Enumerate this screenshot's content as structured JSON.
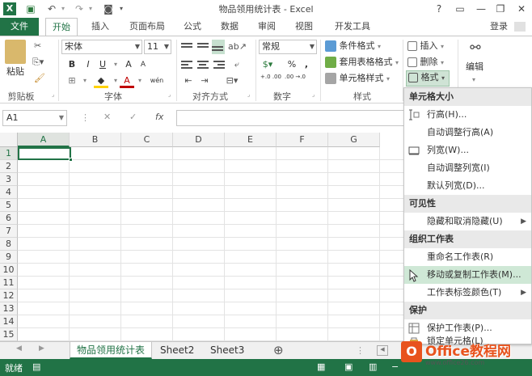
{
  "window": {
    "title": "物品领用统计表 - Excel",
    "help": "?",
    "login": "登录"
  },
  "ribbon_tabs": [
    "文件",
    "开始",
    "插入",
    "页面布局",
    "公式",
    "数据",
    "审阅",
    "视图",
    "开发工具"
  ],
  "ribbon": {
    "clipboard": {
      "label": "剪贴板",
      "paste": "粘贴"
    },
    "font": {
      "label": "字体",
      "font_name": "宋体",
      "font_size": "11",
      "bold": "B",
      "italic": "I",
      "underline": "U",
      "grow": "A",
      "shrink": "A",
      "color_a": "A",
      "wen": "wén"
    },
    "alignment": {
      "label": "对齐方式"
    },
    "number": {
      "label": "数字",
      "format": "常规",
      "percent": "%",
      "comma": ",",
      "inc": "+.0 .00",
      "dec": ".00 →.0"
    },
    "styles": {
      "label": "样式",
      "conditional": "条件格式",
      "table": "套用表格格式",
      "cell": "单元格样式"
    },
    "cells": {
      "insert": "插入",
      "delete": "删除",
      "format": "格式"
    },
    "editing": {
      "label": "编辑"
    }
  },
  "formula_bar": {
    "name_box": "A1",
    "cancel": "✕",
    "enter": "✓",
    "fx": "fx",
    "value": ""
  },
  "grid": {
    "columns": [
      "A",
      "B",
      "C",
      "D",
      "E",
      "F",
      "G"
    ],
    "rows": [
      "1",
      "2",
      "3",
      "4",
      "5",
      "6",
      "7",
      "8",
      "9",
      "10",
      "11",
      "12",
      "13",
      "14",
      "15"
    ]
  },
  "sheets": [
    "物品领用统计表",
    "Sheet2",
    "Sheet3"
  ],
  "add_sheet": "⊕",
  "status": {
    "ready": "就绪"
  },
  "menu": {
    "sections": [
      {
        "header": "单元格大小",
        "items": [
          {
            "label": "行高(H)...",
            "icon": "row-height-icon"
          },
          {
            "label": "自动调整行高(A)"
          },
          {
            "label": "列宽(W)...",
            "icon": "column-width-icon"
          },
          {
            "label": "自动调整列宽(I)"
          },
          {
            "label": "默认列宽(D)..."
          }
        ]
      },
      {
        "header": "可见性",
        "items": [
          {
            "label": "隐藏和取消隐藏(U)",
            "submenu": true
          }
        ]
      },
      {
        "header": "组织工作表",
        "items": [
          {
            "label": "重命名工作表(R)"
          },
          {
            "label": "移动或复制工作表(M)...",
            "highlighted": true
          },
          {
            "label": "工作表标签颜色(T)",
            "submenu": true
          }
        ]
      },
      {
        "header": "保护",
        "items": [
          {
            "label": "保护工作表(P)...",
            "icon": "protect-sheet-icon"
          },
          {
            "label": "锁定单元格(L)",
            "icon": "lock-icon"
          }
        ]
      }
    ]
  },
  "watermark": {
    "brand": "Office教程网",
    "url": "www.office26.com"
  },
  "colors": {
    "excel_green": "#217346",
    "highlight": "#cfe8d6",
    "watermark_orange": "#e8531d"
  }
}
